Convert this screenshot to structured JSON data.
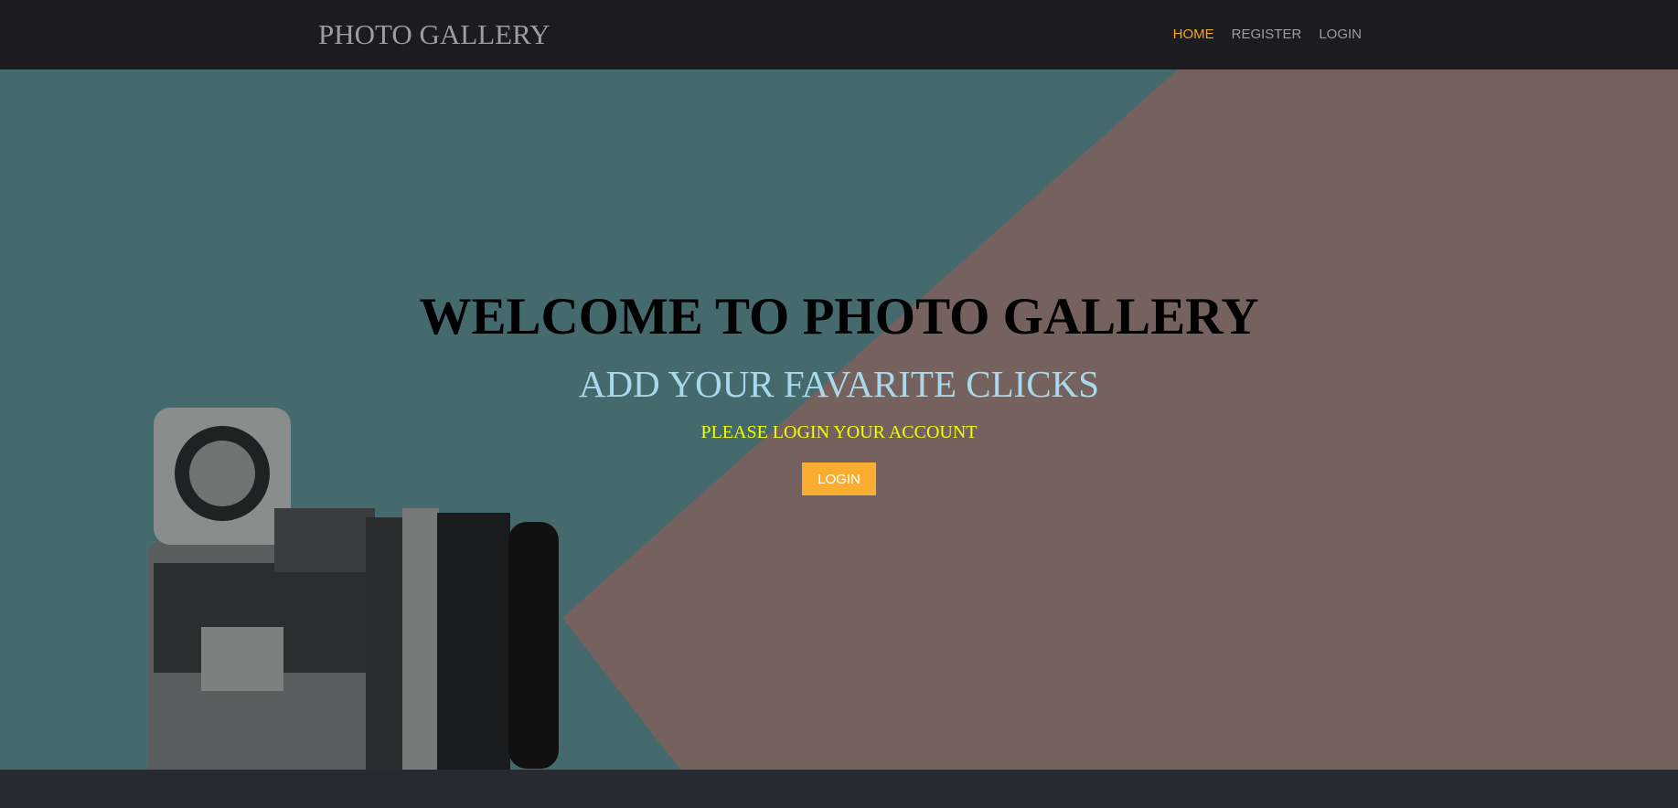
{
  "navbar": {
    "brand": "PHOTO GALLERY",
    "items": [
      {
        "label": "HOME",
        "active": true
      },
      {
        "label": "REGISTER",
        "active": false
      },
      {
        "label": "LOGIN",
        "active": false
      }
    ]
  },
  "hero": {
    "title": "WELCOME TO PHOTO GALLERY",
    "subtitle": "ADD YOUR FAVARITE CLICKS",
    "prompt": "PLEASE LOGIN YOUR ACCOUNT",
    "login_button": "LOGIN"
  },
  "colors": {
    "accent": "#f9ae32",
    "navbar": "#1c1b20",
    "footer": "#272a33"
  }
}
